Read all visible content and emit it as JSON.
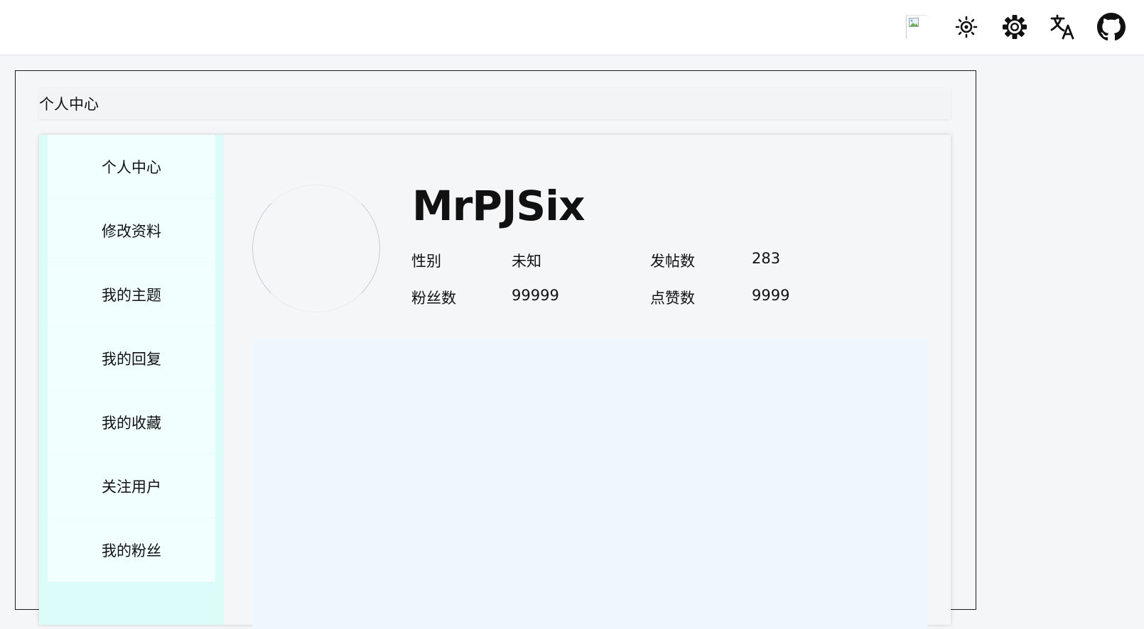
{
  "header": {
    "icons": [
      "broken-avatar-icon",
      "brightness-icon",
      "gear-icon",
      "translate-icon",
      "github-icon"
    ]
  },
  "page": {
    "title": "个人中心"
  },
  "sidebar": {
    "items": [
      {
        "label": "个人中心"
      },
      {
        "label": "修改资料"
      },
      {
        "label": "我的主题"
      },
      {
        "label": "我的回复"
      },
      {
        "label": "我的收藏"
      },
      {
        "label": "关注用户"
      },
      {
        "label": "我的粉丝"
      }
    ]
  },
  "profile": {
    "username": "MrPJSix",
    "gender_label": "性别",
    "gender_value": "未知",
    "posts_label": "发帖数",
    "posts_value": "283",
    "fans_label": "粉丝数",
    "fans_value": "99999",
    "likes_label": "点赞数",
    "likes_value": "9999"
  },
  "colors": {
    "sidebar_bg": "#dcfcfa",
    "sidebar_item_bg": "#f1fffe",
    "content_bg": "#eef6fe",
    "page_bg": "#f5f6f8"
  }
}
